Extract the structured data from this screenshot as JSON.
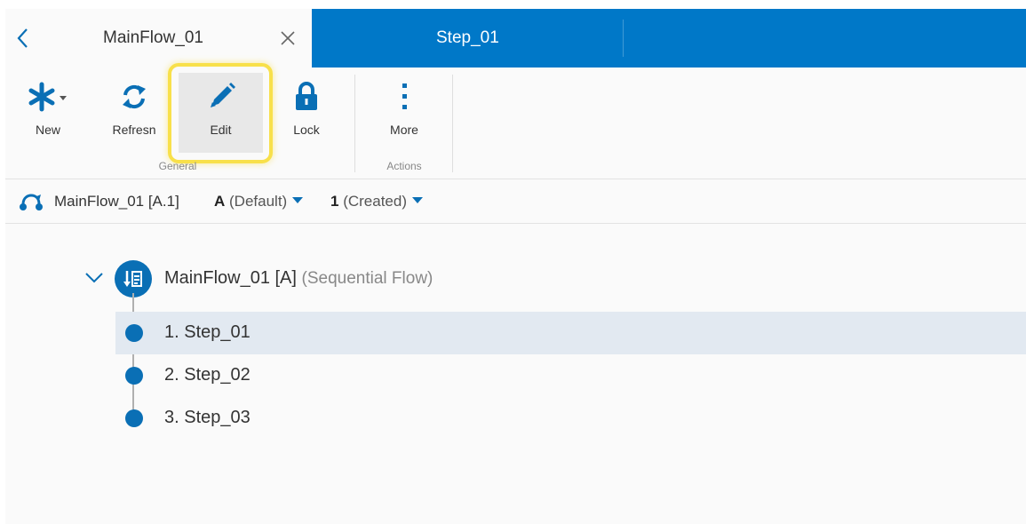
{
  "tabs": {
    "active_title": "MainFlow_01",
    "second_title": "Step_01"
  },
  "toolbar": {
    "new_label": "New",
    "refresh_label": "Refresn",
    "edit_label": "Edit",
    "lock_label": "Lock",
    "more_label": "More",
    "group_general": "General",
    "group_actions": "Actions"
  },
  "context": {
    "item_name": "MainFlow_01 [A.1]",
    "revision_code": "A",
    "revision_name": "(Default)",
    "version_number": "1",
    "version_state": "(Created)"
  },
  "tree": {
    "root_name": "MainFlow_01 [A]",
    "root_type": "(Sequential Flow)",
    "steps": [
      {
        "label": "1. Step_01",
        "selected": true
      },
      {
        "label": "2. Step_02",
        "selected": false
      },
      {
        "label": "3. Step_03",
        "selected": false
      }
    ]
  },
  "colors": {
    "accent": "#0078c8",
    "node_blue": "#0a6fb5",
    "highlight_yellow": "#f8e04a",
    "selected_row": "#e2e9f1"
  },
  "icons": [
    "chevron-left-icon",
    "close-icon",
    "asterisk-icon",
    "refresh-icon",
    "pencil-icon",
    "lock-icon",
    "more-vertical-icon",
    "flow-icon",
    "chevron-down-icon",
    "sequential-flow-icon"
  ]
}
